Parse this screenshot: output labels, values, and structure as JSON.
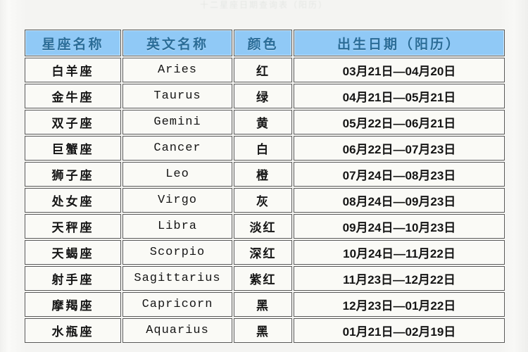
{
  "page": {
    "caption": "十二星座日期查询表（阳历）",
    "background_color": "#f4f4f2"
  },
  "colors": {
    "header_background": "#8fc5ef",
    "header_text": "#2f6d96",
    "cell_background": "#f3f3ef",
    "cell_text": "#1b1b1b",
    "border": "#5a5a58"
  },
  "table": {
    "name": "zodiac-sign-table",
    "columns": [
      {
        "key": "name",
        "label": "星座名称"
      },
      {
        "key": "eng",
        "label": "英文名称"
      },
      {
        "key": "color",
        "label": "颜色"
      },
      {
        "key": "date",
        "label": "出生日期（阳历）"
      }
    ],
    "rows": [
      {
        "name": "白羊座",
        "eng": "Aries",
        "color": "红",
        "date": "03月21日—04月20日"
      },
      {
        "name": "金牛座",
        "eng": "Taurus",
        "color": "绿",
        "date": "04月21日—05月21日"
      },
      {
        "name": "双子座",
        "eng": "Gemini",
        "color": "黄",
        "date": "05月22日—06月21日"
      },
      {
        "name": "巨蟹座",
        "eng": "Cancer",
        "color": "白",
        "date": "06月22日—07月23日"
      },
      {
        "name": "狮子座",
        "eng": "Leo",
        "color": "橙",
        "date": "07月24日—08月23日"
      },
      {
        "name": "处女座",
        "eng": "Virgo",
        "color": "灰",
        "date": "08月24日—09月23日"
      },
      {
        "name": "天秤座",
        "eng": "Libra",
        "color": "淡红",
        "date": "09月24日—10月23日"
      },
      {
        "name": "天蝎座",
        "eng": "Scorpio",
        "color": "深红",
        "date": "10月24日—11月22日"
      },
      {
        "name": "射手座",
        "eng": "Sagittarius",
        "color": "紫红",
        "date": "11月23日—12月22日"
      },
      {
        "name": "摩羯座",
        "eng": "Capricorn",
        "color": "黑",
        "date": "12月23日—01月22日"
      },
      {
        "name": "水瓶座",
        "eng": "Aquarius",
        "color": "黑",
        "date": "01月21日—02月19日"
      }
    ]
  }
}
